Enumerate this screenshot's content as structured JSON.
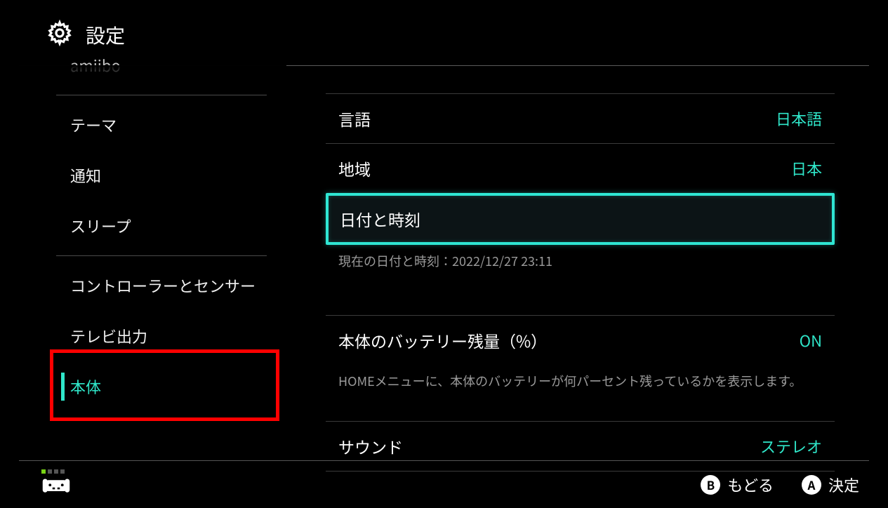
{
  "header": {
    "title": "設定"
  },
  "sidebar": {
    "items": [
      {
        "label": "amiibo"
      },
      {
        "label": "テーマ"
      },
      {
        "label": "通知"
      },
      {
        "label": "スリープ"
      },
      {
        "label": "コントローラーとセンサー"
      },
      {
        "label": "テレビ出力"
      },
      {
        "label": "本体"
      }
    ]
  },
  "content": {
    "language": {
      "label": "言語",
      "value": "日本語"
    },
    "region": {
      "label": "地域",
      "value": "日本"
    },
    "datetime": {
      "label": "日付と時刻",
      "desc": "現在の日付と時刻：2022/12/27 23:11"
    },
    "battery": {
      "label": "本体のバッテリー残量（%）",
      "value": "ON",
      "desc": "HOMEメニューに、本体のバッテリーが何パーセント残っているかを表示します。"
    },
    "sound": {
      "label": "サウンド",
      "value": "ステレオ"
    }
  },
  "footer": {
    "back": {
      "button": "B",
      "label": "もどる"
    },
    "select": {
      "button": "A",
      "label": "決定"
    }
  }
}
